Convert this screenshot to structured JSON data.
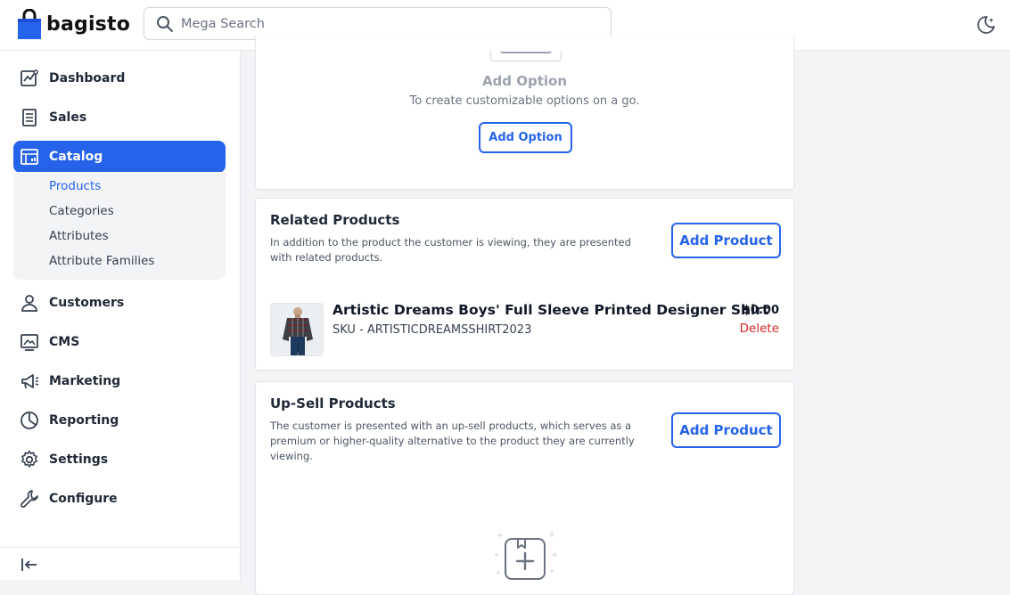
{
  "header": {
    "brand": "bagisto",
    "search_placeholder": "Mega Search"
  },
  "sidebar": {
    "items": [
      {
        "label": "Dashboard",
        "icon": "dashboard-icon"
      },
      {
        "label": "Sales",
        "icon": "sales-icon"
      },
      {
        "label": "Catalog",
        "icon": "catalog-icon",
        "active": true
      },
      {
        "label": "Customers",
        "icon": "customers-icon"
      },
      {
        "label": "CMS",
        "icon": "cms-icon"
      },
      {
        "label": "Marketing",
        "icon": "marketing-icon"
      },
      {
        "label": "Reporting",
        "icon": "reporting-icon"
      },
      {
        "label": "Settings",
        "icon": "settings-icon"
      },
      {
        "label": "Configure",
        "icon": "configure-icon"
      }
    ],
    "catalog_submenu": [
      "Products",
      "Categories",
      "Attributes",
      "Attribute Families"
    ]
  },
  "customizable_options": {
    "empty_title": "Add Option",
    "empty_desc": "To create customizable options on a go.",
    "button": "Add Option"
  },
  "related_products": {
    "title": "Related Products",
    "description": "In addition to the product the customer is viewing, they are presented with related products.",
    "button": "Add Product",
    "items": [
      {
        "name": "Artistic Dreams Boys' Full Sleeve Printed Designer Shirt",
        "sku": "SKU - ARTISTICDREAMSSHIRT2023",
        "price": "$0.00",
        "action": "Delete"
      }
    ]
  },
  "up_sell_products": {
    "title": "Up-Sell Products",
    "description": "The customer is presented with an up-sell products, which serves as a premium or higher-quality alternative to the product they are currently viewing.",
    "button": "Add Product"
  },
  "colors": {
    "accent": "#2563eb",
    "danger": "#dc2626"
  }
}
